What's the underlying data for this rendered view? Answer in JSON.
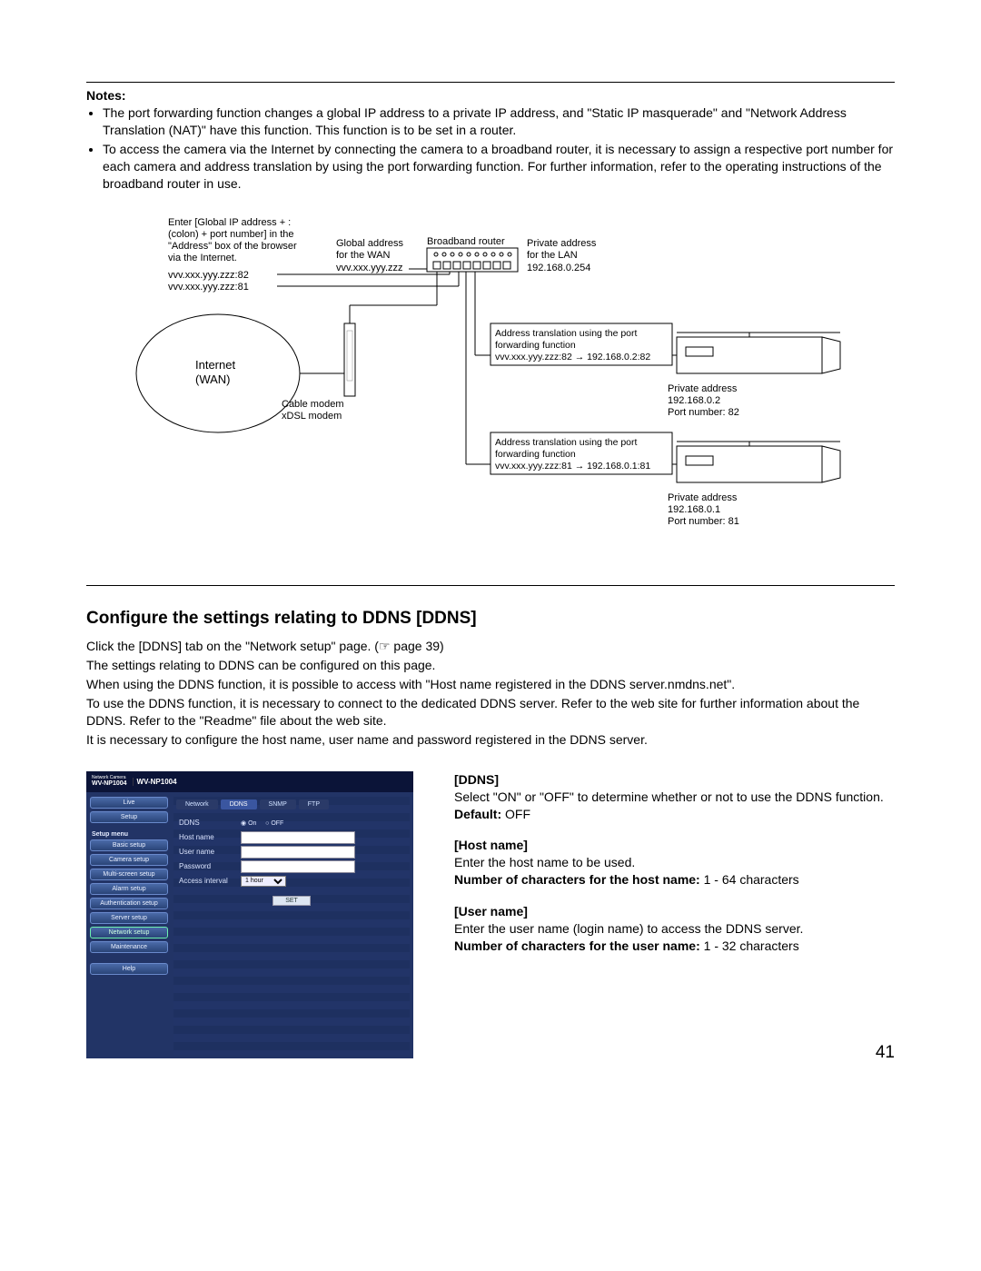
{
  "notes": {
    "heading": "Notes:",
    "items": [
      "The port forwarding function changes a global IP address to a private IP address, and \"Static IP masquerade\" and \"Network Address Translation (NAT)\" have this function. This function is to be set in a router.",
      "To access the camera via the Internet by connecting the camera to a broadband router, it is necessary to assign a respective port number for each camera and address translation by using the port forwarding function. For further information, refer to the operating instructions of the broadband router in use."
    ]
  },
  "diagram": {
    "browser_note_l1": "Enter [Global IP address + :",
    "browser_note_l2": "(colon) + port number] in the",
    "browser_note_l3": "\"Address\" box of the browser",
    "browser_note_l4": "via the Internet.",
    "wan_url1": "vvv.xxx.yyy.zzz:82",
    "wan_url2": "vvv.xxx.yyy.zzz:81",
    "global_addr_l1": "Global address",
    "global_addr_l2": "for the WAN",
    "global_addr_l3": "vvv.xxx.yyy.zzz",
    "router_label": "Broadband router",
    "private_addr_l1": "Private address",
    "private_addr_l2": "for the LAN",
    "private_addr_l3": "192.168.0.254",
    "internet_l1": "Internet",
    "internet_l2": "(WAN)",
    "modem_l1": "Cable modem",
    "modem_l2": "xDSL modem",
    "trans1_l1": "Address translation using the port",
    "trans1_l2": "forwarding function",
    "trans1_l3": "vvv.xxx.yyy.zzz:82 → 192.168.0.2:82",
    "cam1_l1": "Private address",
    "cam1_l2": "192.168.0.2",
    "cam1_l3": "Port number: 82",
    "trans2_l1": "Address translation using the port",
    "trans2_l2": "forwarding function",
    "trans2_l3": "vvv.xxx.yyy.zzz:81 → 192.168.0.1:81",
    "cam2_l1": "Private address",
    "cam2_l2": "192.168.0.1",
    "cam2_l3": "Port number: 81"
  },
  "ddns_section": {
    "title": "Configure the settings relating to DDNS [DDNS]",
    "p1": "Click the [DDNS] tab on the \"Network setup\" page. (☞ page 39)",
    "p2": "The settings relating to DDNS can be configured on this page.",
    "p3": "When using the DDNS function, it is possible to access with \"Host name registered in the DDNS server.nmdns.net\".",
    "p4": "To use the DDNS function, it is necessary to connect to the dedicated DDNS server. Refer to the web site for further information about the DDNS. Refer to the \"Readme\" file about the web site.",
    "p5": "It is necessary to configure the host name, user name and password registered in the DDNS server."
  },
  "ui": {
    "model_small": "Network Camera",
    "model_code": "WV-NP1004",
    "title_model": "WV-NP1004",
    "live_btn": "Live",
    "setup_btn": "Setup",
    "menu_head": "Setup menu",
    "menu": [
      "Basic setup",
      "Camera setup",
      "Multi-screen setup",
      "Alarm setup",
      "Authentication setup",
      "Server setup",
      "Network setup",
      "Maintenance"
    ],
    "help_btn": "Help",
    "tabs": [
      "Network",
      "DDNS",
      "SNMP",
      "FTP"
    ],
    "form": {
      "ddns_label": "DDNS",
      "on": "On",
      "off": "OFF",
      "host": "Host name",
      "user": "User name",
      "pass": "Password",
      "interval": "Access interval",
      "interval_val": "1 hour",
      "set_btn": "SET"
    }
  },
  "right": {
    "ddns_label": "[DDNS]",
    "ddns_text": "Select \"ON\" or \"OFF\" to determine whether or not to use the DDNS function.",
    "default_label": "Default:",
    "default_val": " OFF",
    "host_label": "[Host name]",
    "host_text": "Enter the host name to be used.",
    "host_chars_label": "Number of characters for the host name:",
    "host_chars_val": " 1 - 64 characters",
    "user_label": "[User name]",
    "user_text": "Enter the user name (login name) to access the DDNS server.",
    "user_chars_label": "Number of characters for the user name:",
    "user_chars_val": " 1 - 32 characters"
  },
  "page_number": "41"
}
